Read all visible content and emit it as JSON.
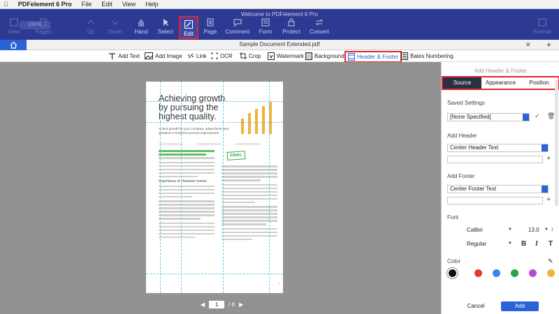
{
  "menubar": {
    "app": "PDFelement 6 Pro",
    "items": [
      "File",
      "Edit",
      "View",
      "Help"
    ]
  },
  "window": {
    "title": "Welcome to PDFelement 6 Pro"
  },
  "toolbar": {
    "zoom": "231%",
    "items": [
      {
        "label": "View",
        "icon": "view-icon",
        "enabled": false
      },
      {
        "label": "Pages",
        "icon": "pages-icon",
        "enabled": false
      },
      {
        "label": "Up",
        "icon": "up-icon",
        "enabled": false
      },
      {
        "label": "Down",
        "icon": "down-icon",
        "enabled": false
      },
      {
        "label": "Hand",
        "icon": "hand-icon",
        "enabled": true
      },
      {
        "label": "Select",
        "icon": "cursor-icon",
        "enabled": true
      },
      {
        "label": "Edit",
        "icon": "edit-icon",
        "enabled": true,
        "active": true
      },
      {
        "label": "Page",
        "icon": "page-icon",
        "enabled": true
      },
      {
        "label": "Comment",
        "icon": "comment-icon",
        "enabled": true
      },
      {
        "label": "Form",
        "icon": "form-icon",
        "enabled": true
      },
      {
        "label": "Protect",
        "icon": "protect-icon",
        "enabled": true
      },
      {
        "label": "Convert",
        "icon": "convert-icon",
        "enabled": true
      },
      {
        "label": "Format",
        "icon": "format-icon",
        "enabled": false
      }
    ]
  },
  "tabbar": {
    "title": "Sample Document Extended.pdf"
  },
  "edit_tools": [
    {
      "label": "Add Text",
      "icon": "text-icon"
    },
    {
      "label": "Add Image",
      "icon": "image-icon"
    },
    {
      "label": "Link",
      "icon": "link-icon"
    },
    {
      "label": "OCR",
      "icon": "ocr-icon"
    },
    {
      "label": "Crop",
      "icon": "crop-icon"
    },
    {
      "label": "Watermark",
      "icon": "watermark-icon"
    },
    {
      "label": "Background",
      "icon": "background-icon"
    },
    {
      "label": "Header & Footer",
      "icon": "header-footer-icon",
      "active": true
    },
    {
      "label": "Bates Numbering",
      "icon": "bates-icon"
    }
  ],
  "page": {
    "heading": "Achieving growth by pursuing the highest quality.",
    "subheading": "Unlock growth for your company, adopt these best practices in business process improvement.",
    "section": "Importance of character homes",
    "stamp": "FINAL"
  },
  "pager": {
    "current": "1",
    "total": "/ 6"
  },
  "panel": {
    "title": "Add Header & Footer",
    "tabs": [
      "Source",
      "Appearance",
      "Position"
    ],
    "saved_label": "Saved Settings",
    "saved_value": "[None Specified]",
    "header_label": "Add Header",
    "header_value": "Center Header Text",
    "footer_label": "Add Footer",
    "footer_value": "Center Footer Text",
    "font_label": "Font",
    "font_family": "Calibri",
    "font_size": "13.0",
    "font_style": "Regular",
    "bold": "B",
    "italic": "I",
    "underline": "T",
    "color_label": "Color",
    "colors": [
      "#111111",
      "#e53935",
      "#3b82f6",
      "#22a846",
      "#b44bd6",
      "#f2b23a"
    ],
    "cancel": "Cancel",
    "add": "Add"
  }
}
